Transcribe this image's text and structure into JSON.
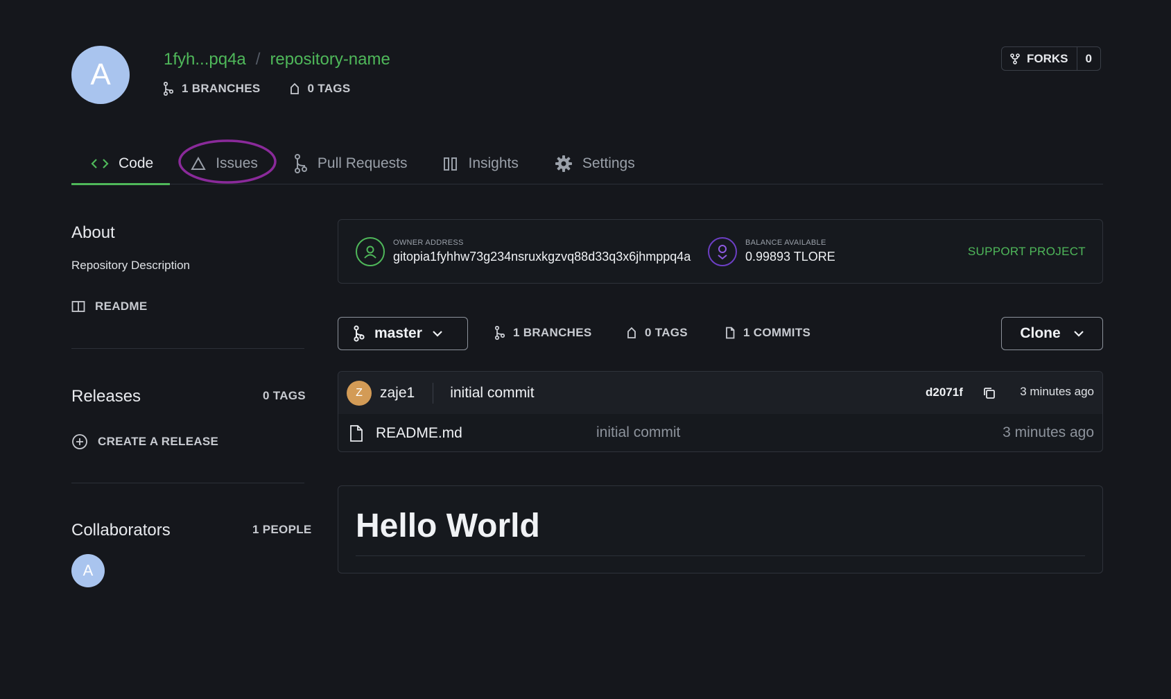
{
  "header": {
    "avatar_letter": "A",
    "owner_short": "1fyh...pq4a",
    "separator": "/",
    "repo_name": "repository-name",
    "branches": "1 BRANCHES",
    "tags": "0 TAGS",
    "forks_label": "FORKS",
    "forks_count": "0"
  },
  "tabs": [
    {
      "label": "Code",
      "icon": "code-icon",
      "active": true
    },
    {
      "label": "Issues",
      "icon": "triangle-icon",
      "active": false
    },
    {
      "label": "Pull Requests",
      "icon": "pull-request-icon",
      "active": false
    },
    {
      "label": "Insights",
      "icon": "bar-chart-icon",
      "active": false
    },
    {
      "label": "Settings",
      "icon": "gear-icon",
      "active": false
    }
  ],
  "sidebar": {
    "about_title": "About",
    "description": "Repository Description",
    "readme_link": "README",
    "releases_title": "Releases",
    "releases_count": "0 TAGS",
    "create_release": "CREATE A RELEASE",
    "collaborators_title": "Collaborators",
    "collaborators_count": "1 PEOPLE",
    "collaborator_letter": "A"
  },
  "owner_card": {
    "owner_caption": "OWNER ADDRESS",
    "owner_address": "gitopia1fyhhw73g234nsruxkgzvq88d33q3x6jhmppq4a",
    "balance_caption": "BALANCE AVAILABLE",
    "balance": "0.99893 TLORE",
    "support": "SUPPORT PROJECT"
  },
  "branch_bar": {
    "branch": "master",
    "branches": "1 BRANCHES",
    "tags": "0 TAGS",
    "commits": "1 COMMITS",
    "clone": "Clone"
  },
  "commit": {
    "avatar_letter": "Z",
    "author": "zaje1",
    "message": "initial commit",
    "hash": "d2071f",
    "time": "3 minutes ago"
  },
  "files": [
    {
      "name": "README.md",
      "message": "initial commit",
      "time": "3 minutes ago"
    }
  ],
  "readme": {
    "heading": "Hello World"
  },
  "colors": {
    "accent": "#4fb85a",
    "annotation_ring": "#8a2a9a",
    "background": "#15171c"
  }
}
